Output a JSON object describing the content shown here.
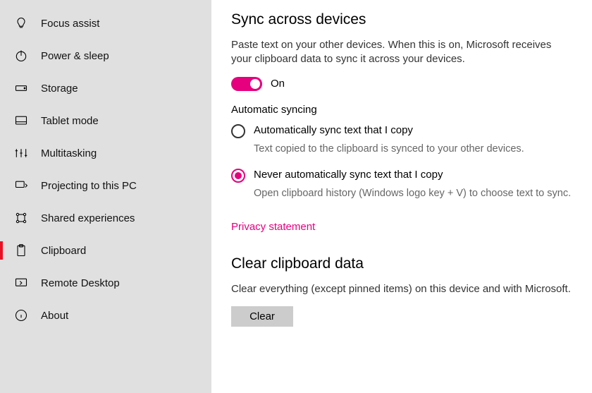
{
  "sidebar": {
    "items": [
      {
        "icon": "focus-assist-icon",
        "label": "Focus assist",
        "active": false
      },
      {
        "icon": "power-icon",
        "label": "Power & sleep",
        "active": false
      },
      {
        "icon": "storage-icon",
        "label": "Storage",
        "active": false
      },
      {
        "icon": "tablet-icon",
        "label": "Tablet mode",
        "active": false
      },
      {
        "icon": "multitask-icon",
        "label": "Multitasking",
        "active": false
      },
      {
        "icon": "project-icon",
        "label": "Projecting to this PC",
        "active": false
      },
      {
        "icon": "shared-icon",
        "label": "Shared experiences",
        "active": false
      },
      {
        "icon": "clipboard-icon",
        "label": "Clipboard",
        "active": true
      },
      {
        "icon": "remote-icon",
        "label": "Remote Desktop",
        "active": false
      },
      {
        "icon": "about-icon",
        "label": "About",
        "active": false
      }
    ]
  },
  "sync": {
    "title": "Sync across devices",
    "description": "Paste text on your other devices. When this is on, Microsoft receives your clipboard data to sync it across your devices.",
    "toggle_state": "On",
    "auto_heading": "Automatic syncing",
    "options": {
      "auto": {
        "label": "Automatically sync text that I copy",
        "desc": "Text copied to the clipboard is synced to your other devices.",
        "checked": false
      },
      "never": {
        "label": "Never automatically sync text that I copy",
        "desc": "Open clipboard history (Windows logo key + V) to choose text to sync.",
        "checked": true
      }
    },
    "privacy_link": "Privacy statement"
  },
  "clear": {
    "title": "Clear clipboard data",
    "description": "Clear everything (except pinned items) on this device and with Microsoft.",
    "button": "Clear"
  }
}
